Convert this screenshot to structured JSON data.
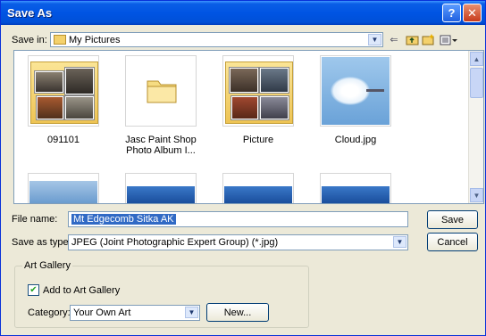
{
  "window": {
    "title": "Save As"
  },
  "save_in": {
    "label": "Save in:",
    "value": "My Pictures"
  },
  "files": [
    {
      "name": "091101",
      "type": "folder-with-photos"
    },
    {
      "name": "Jasc Paint Shop Photo Album I...",
      "type": "folder"
    },
    {
      "name": "Picture",
      "type": "folder-with-photos"
    },
    {
      "name": "Cloud.jpg",
      "type": "image"
    }
  ],
  "file_name": {
    "label": "File name:",
    "value": "Mt Edgecomb Sitka AK"
  },
  "save_as_type": {
    "label": "Save as type:",
    "value": "JPEG (Joint Photographic Expert Group) (*.jpg)"
  },
  "buttons": {
    "save": "Save",
    "cancel": "Cancel",
    "new": "New..."
  },
  "art_gallery": {
    "legend": "Art Gallery",
    "add_label": "Add to Art Gallery",
    "add_checked": true,
    "category_label": "Category:",
    "category_value": "Your Own Art"
  },
  "colors": {
    "title_bar": "#0054e3",
    "selection": "#316ac5",
    "folder": "#f4d16b"
  }
}
